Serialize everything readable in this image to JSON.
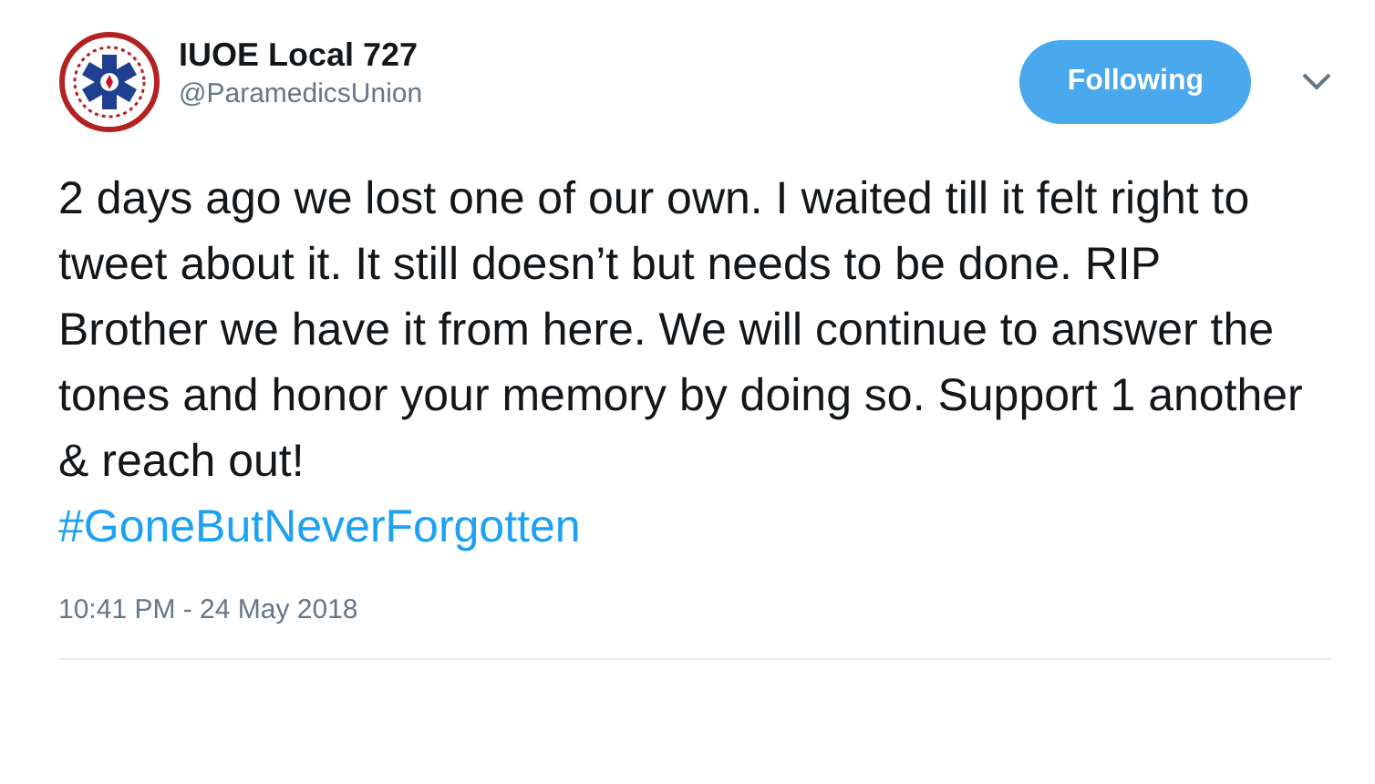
{
  "author": {
    "name": "IUOE Local 727",
    "handle": "@ParamedicsUnion"
  },
  "follow_button": {
    "label": "Following",
    "selected": true
  },
  "tweet": {
    "text": "2 days ago we lost one of our own. I waited till it felt right to tweet about it. It still doesn’t but needs to be done. RIP Brother we have it from here. We will continue to answer the tones and honor your memory by doing so. Support 1 another & reach out!",
    "hashtag": "#GoneButNeverForgotten",
    "timestamp": "10:41 PM - 24 May 2018"
  }
}
